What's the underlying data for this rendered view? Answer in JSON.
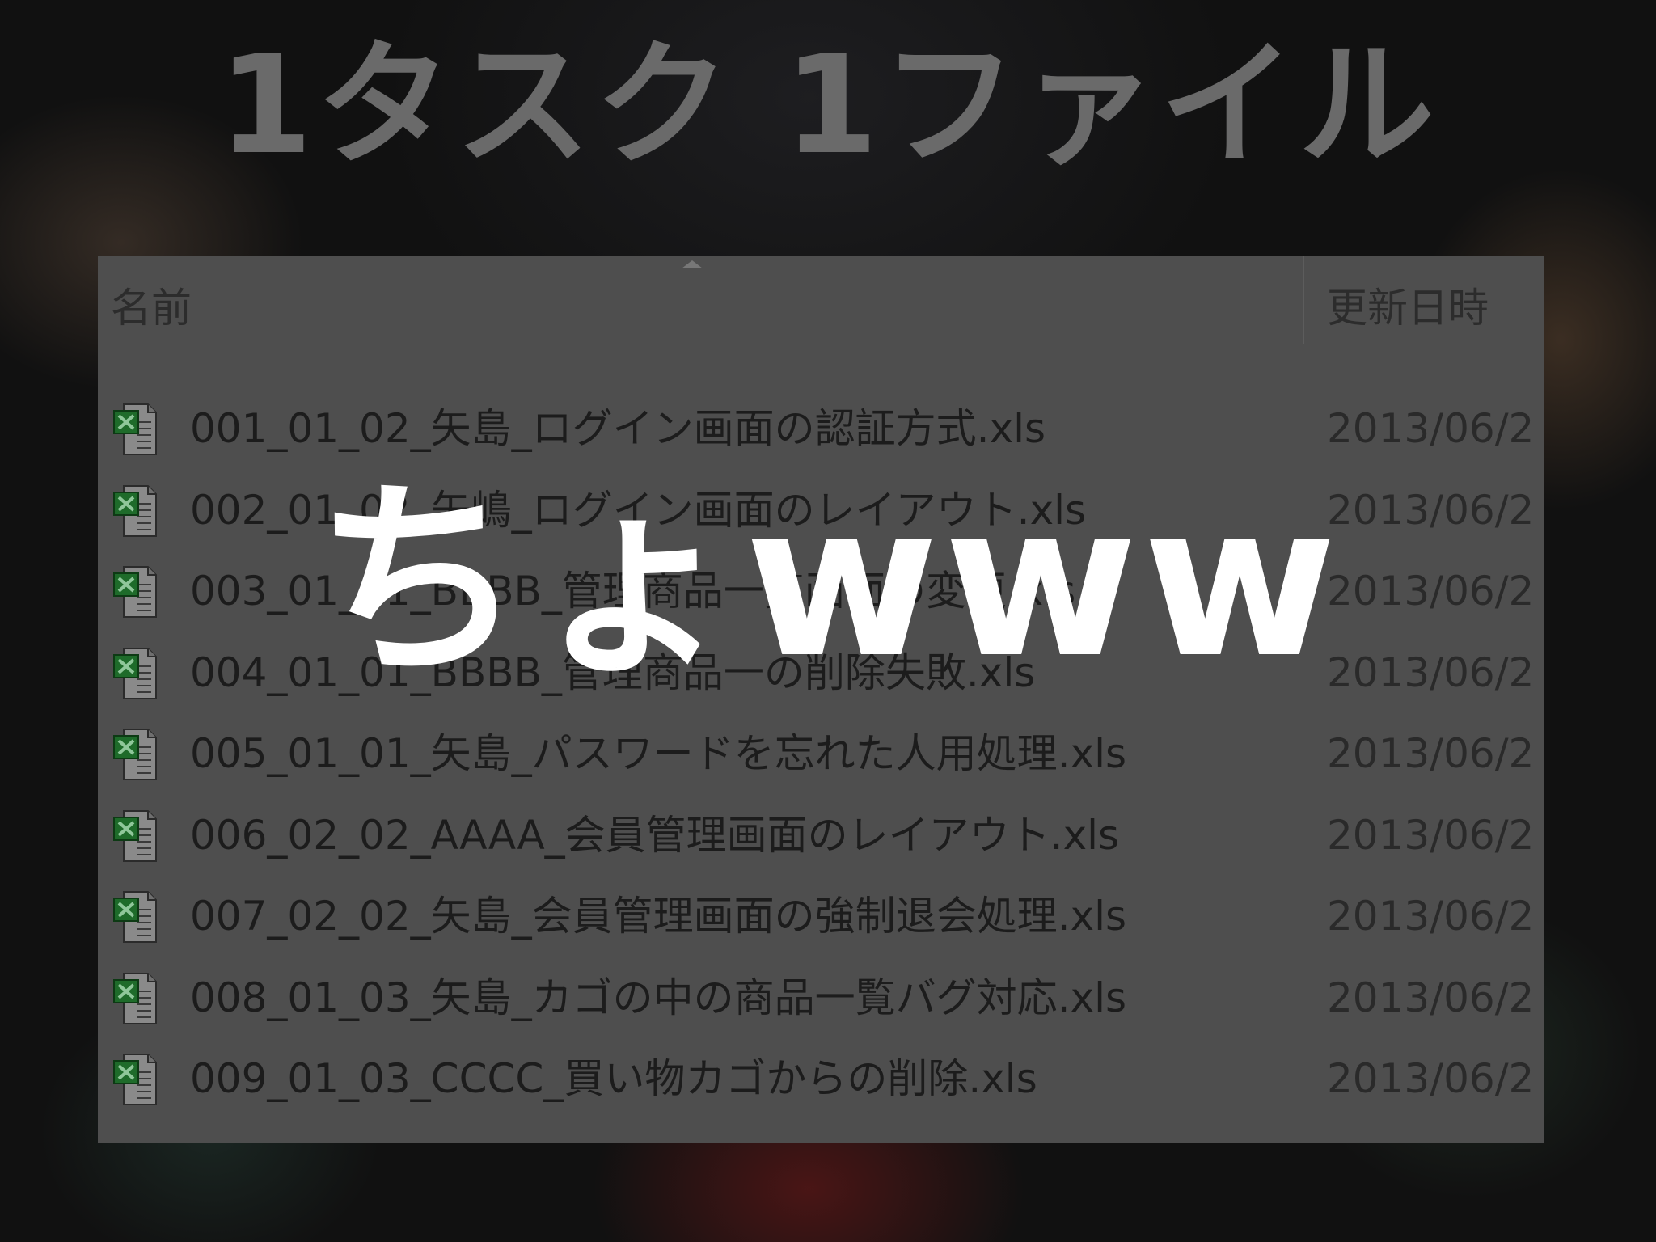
{
  "slide": {
    "title": "1タスク 1ファイル",
    "overlay_text": "ちょwww"
  },
  "explorer": {
    "columns": {
      "name": "名前",
      "modified": "更新日時"
    },
    "files": [
      {
        "name": "001_01_02_矢島_ログイン画面の認証方式.xls",
        "date": "2013/06/2"
      },
      {
        "name": "002_01_02_矢嶋_ログイン画面のレイアウト.xls",
        "date": "2013/06/2"
      },
      {
        "name": "003_01_01_BBBB_管理商品一覧画面の変更.xls",
        "date": "2013/06/2"
      },
      {
        "name": "004_01_01_BBBB_管理商品一の削除失敗.xls",
        "date": "2013/06/2"
      },
      {
        "name": "005_01_01_矢島_パスワードを忘れた人用処理.xls",
        "date": "2013/06/2"
      },
      {
        "name": "006_02_02_AAAA_会員管理画面のレイアウト.xls",
        "date": "2013/06/2"
      },
      {
        "name": "007_02_02_矢島_会員管理画面の強制退会処理.xls",
        "date": "2013/06/2"
      },
      {
        "name": "008_01_03_矢島_カゴの中の商品一覧バグ対応.xls",
        "date": "2013/06/2"
      },
      {
        "name": "009_01_03_CCCC_買い物カゴからの削除.xls",
        "date": "2013/06/2"
      }
    ],
    "icon": "excel-file-icon"
  },
  "colors": {
    "explorer_background": "#4e4e4e",
    "title_text": "#6a6a6a",
    "overlay_text": "#ffffff",
    "excel_green": "#1e6b2a"
  }
}
